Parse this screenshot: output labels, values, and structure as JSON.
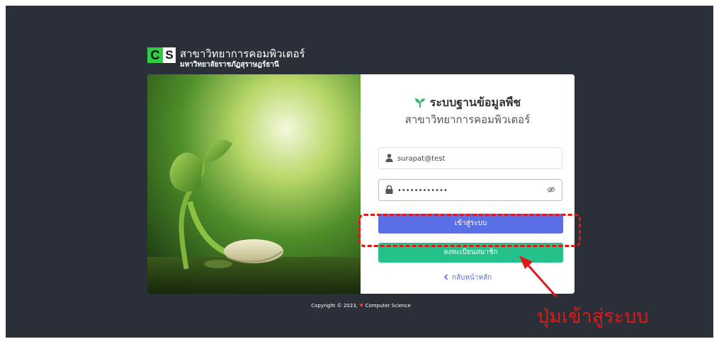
{
  "brand": {
    "logo_letter_c": "C",
    "logo_letter_s": "S",
    "title": "สาขาวิทยาการคอมพิวเตอร์",
    "subtitle": "มหาวิทยาลัยราชภัฏสุราษฎร์ธานี"
  },
  "login": {
    "system_title": "ระบบฐานข้อมูลพืช",
    "system_subtitle": "สาขาวิทยาการคอมพิวเตอร์",
    "username_value": "surapat@test",
    "password_value": "••••••••••••",
    "login_label": "เข้าสู่ระบบ",
    "register_label": "ลงทะเบียนสมาชิก",
    "back_label": "กลับหน้าหลัก"
  },
  "footer": {
    "copyright": "Copyright © 2023,",
    "org": "Computer Science"
  },
  "annotation": {
    "caption": "ปุ่มเข้าสู่ระบบ"
  },
  "colors": {
    "background": "#2b3038",
    "login_button": "#5b6fe6",
    "register_button": "#25c18a",
    "annotation": "#e01818"
  },
  "icons": [
    "sprout-icon",
    "user-icon",
    "lock-icon",
    "eye-off-icon",
    "chevron-left-icon",
    "heart-icon"
  ]
}
